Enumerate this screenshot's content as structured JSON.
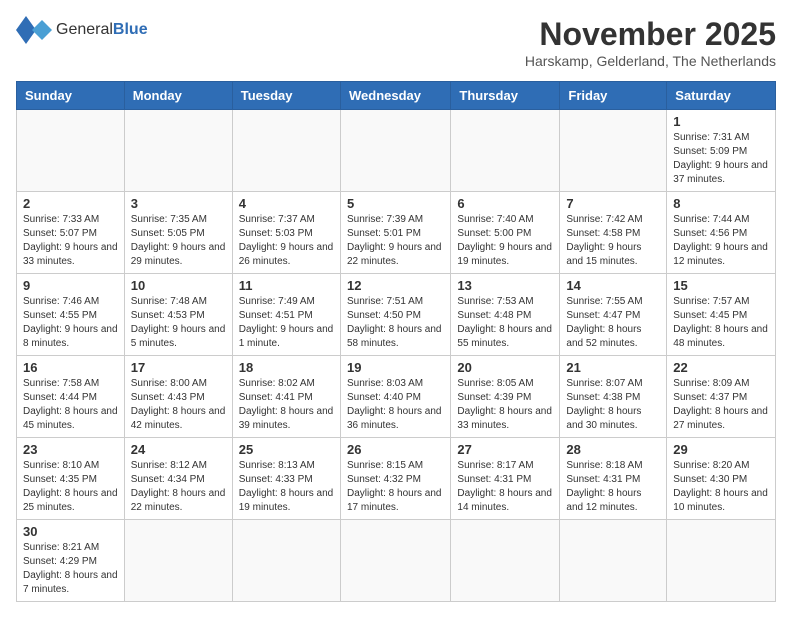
{
  "logo": {
    "text_general": "General",
    "text_blue": "Blue"
  },
  "title": "November 2025",
  "subtitle": "Harskamp, Gelderland, The Netherlands",
  "weekdays": [
    "Sunday",
    "Monday",
    "Tuesday",
    "Wednesday",
    "Thursday",
    "Friday",
    "Saturday"
  ],
  "weeks": [
    [
      {
        "day": "",
        "info": ""
      },
      {
        "day": "",
        "info": ""
      },
      {
        "day": "",
        "info": ""
      },
      {
        "day": "",
        "info": ""
      },
      {
        "day": "",
        "info": ""
      },
      {
        "day": "",
        "info": ""
      },
      {
        "day": "1",
        "info": "Sunrise: 7:31 AM\nSunset: 5:09 PM\nDaylight: 9 hours and 37 minutes."
      }
    ],
    [
      {
        "day": "2",
        "info": "Sunrise: 7:33 AM\nSunset: 5:07 PM\nDaylight: 9 hours and 33 minutes."
      },
      {
        "day": "3",
        "info": "Sunrise: 7:35 AM\nSunset: 5:05 PM\nDaylight: 9 hours and 29 minutes."
      },
      {
        "day": "4",
        "info": "Sunrise: 7:37 AM\nSunset: 5:03 PM\nDaylight: 9 hours and 26 minutes."
      },
      {
        "day": "5",
        "info": "Sunrise: 7:39 AM\nSunset: 5:01 PM\nDaylight: 9 hours and 22 minutes."
      },
      {
        "day": "6",
        "info": "Sunrise: 7:40 AM\nSunset: 5:00 PM\nDaylight: 9 hours and 19 minutes."
      },
      {
        "day": "7",
        "info": "Sunrise: 7:42 AM\nSunset: 4:58 PM\nDaylight: 9 hours and 15 minutes."
      },
      {
        "day": "8",
        "info": "Sunrise: 7:44 AM\nSunset: 4:56 PM\nDaylight: 9 hours and 12 minutes."
      }
    ],
    [
      {
        "day": "9",
        "info": "Sunrise: 7:46 AM\nSunset: 4:55 PM\nDaylight: 9 hours and 8 minutes."
      },
      {
        "day": "10",
        "info": "Sunrise: 7:48 AM\nSunset: 4:53 PM\nDaylight: 9 hours and 5 minutes."
      },
      {
        "day": "11",
        "info": "Sunrise: 7:49 AM\nSunset: 4:51 PM\nDaylight: 9 hours and 1 minute."
      },
      {
        "day": "12",
        "info": "Sunrise: 7:51 AM\nSunset: 4:50 PM\nDaylight: 8 hours and 58 minutes."
      },
      {
        "day": "13",
        "info": "Sunrise: 7:53 AM\nSunset: 4:48 PM\nDaylight: 8 hours and 55 minutes."
      },
      {
        "day": "14",
        "info": "Sunrise: 7:55 AM\nSunset: 4:47 PM\nDaylight: 8 hours and 52 minutes."
      },
      {
        "day": "15",
        "info": "Sunrise: 7:57 AM\nSunset: 4:45 PM\nDaylight: 8 hours and 48 minutes."
      }
    ],
    [
      {
        "day": "16",
        "info": "Sunrise: 7:58 AM\nSunset: 4:44 PM\nDaylight: 8 hours and 45 minutes."
      },
      {
        "day": "17",
        "info": "Sunrise: 8:00 AM\nSunset: 4:43 PM\nDaylight: 8 hours and 42 minutes."
      },
      {
        "day": "18",
        "info": "Sunrise: 8:02 AM\nSunset: 4:41 PM\nDaylight: 8 hours and 39 minutes."
      },
      {
        "day": "19",
        "info": "Sunrise: 8:03 AM\nSunset: 4:40 PM\nDaylight: 8 hours and 36 minutes."
      },
      {
        "day": "20",
        "info": "Sunrise: 8:05 AM\nSunset: 4:39 PM\nDaylight: 8 hours and 33 minutes."
      },
      {
        "day": "21",
        "info": "Sunrise: 8:07 AM\nSunset: 4:38 PM\nDaylight: 8 hours and 30 minutes."
      },
      {
        "day": "22",
        "info": "Sunrise: 8:09 AM\nSunset: 4:37 PM\nDaylight: 8 hours and 27 minutes."
      }
    ],
    [
      {
        "day": "23",
        "info": "Sunrise: 8:10 AM\nSunset: 4:35 PM\nDaylight: 8 hours and 25 minutes."
      },
      {
        "day": "24",
        "info": "Sunrise: 8:12 AM\nSunset: 4:34 PM\nDaylight: 8 hours and 22 minutes."
      },
      {
        "day": "25",
        "info": "Sunrise: 8:13 AM\nSunset: 4:33 PM\nDaylight: 8 hours and 19 minutes."
      },
      {
        "day": "26",
        "info": "Sunrise: 8:15 AM\nSunset: 4:32 PM\nDaylight: 8 hours and 17 minutes."
      },
      {
        "day": "27",
        "info": "Sunrise: 8:17 AM\nSunset: 4:31 PM\nDaylight: 8 hours and 14 minutes."
      },
      {
        "day": "28",
        "info": "Sunrise: 8:18 AM\nSunset: 4:31 PM\nDaylight: 8 hours and 12 minutes."
      },
      {
        "day": "29",
        "info": "Sunrise: 8:20 AM\nSunset: 4:30 PM\nDaylight: 8 hours and 10 minutes."
      }
    ],
    [
      {
        "day": "30",
        "info": "Sunrise: 8:21 AM\nSunset: 4:29 PM\nDaylight: 8 hours and 7 minutes."
      },
      {
        "day": "",
        "info": ""
      },
      {
        "day": "",
        "info": ""
      },
      {
        "day": "",
        "info": ""
      },
      {
        "day": "",
        "info": ""
      },
      {
        "day": "",
        "info": ""
      },
      {
        "day": "",
        "info": ""
      }
    ]
  ]
}
